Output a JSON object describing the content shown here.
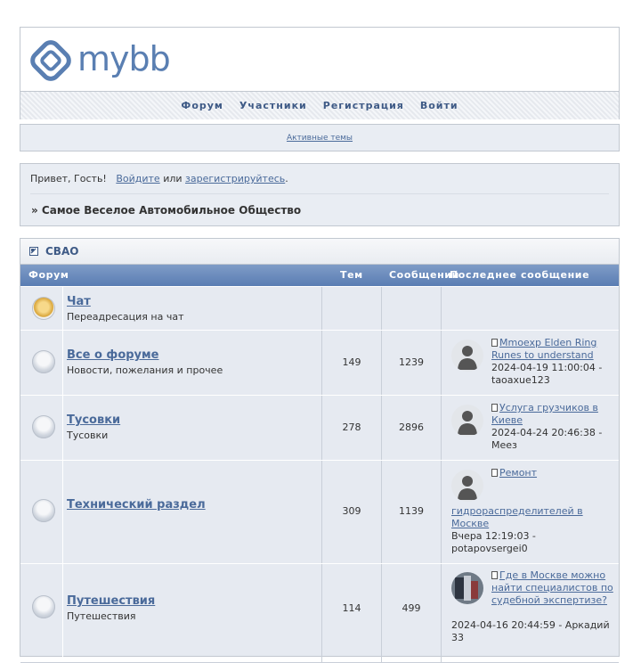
{
  "header": {
    "logo_text": "mybb",
    "nav": [
      "Форум",
      "Участники",
      "Регистрация",
      "Войти"
    ]
  },
  "active_topics": "Активные темы",
  "welcome": {
    "greeting": "Привет, Гость!",
    "login": "Войдите",
    "or": "или",
    "register": "зарегистрируйтесь",
    "period": ".",
    "breadcrumb": "» Самое Веселое Автомобильное Общество"
  },
  "category": {
    "title": "СВАО",
    "columns": {
      "forum": "Форум",
      "threads": "Тем",
      "posts": "Сообщений",
      "last": "Последнее сообщение"
    },
    "forums": [
      {
        "name": "Чат",
        "desc": "Переадресация на чат",
        "threads": "",
        "posts": ""
      },
      {
        "name": "Все о форуме",
        "desc": "Новости, пожелания и прочее",
        "threads": "149",
        "posts": "1239",
        "last_title": "Mmoexp Elden Ring Runes to understand",
        "last_date": "2024-04-19 11:00:04",
        "last_author": "taoaxue123"
      },
      {
        "name": "Тусовки",
        "desc": "Тусовки",
        "threads": "278",
        "posts": "2896",
        "last_title": "Услуга грузчиков в Киеве",
        "last_date": "2024-04-24 20:46:38",
        "last_author": "Меез"
      },
      {
        "name": "Технический раздел",
        "desc": "",
        "threads": "309",
        "posts": "1139",
        "last_title_a": "Ремонт",
        "last_title_b": "гидрораспределителей в Москве",
        "last_date": "Вчера 12:19:03",
        "last_author": "potapovsergei0"
      },
      {
        "name": "Путешествия",
        "desc": "Путешествия",
        "threads": "114",
        "posts": "499",
        "last_title": "Где в Москве можно найти специалистов по судебной экспертизе?",
        "last_date": "2024-04-16 20:44:59",
        "last_author": "Аркадий 33"
      }
    ]
  }
}
